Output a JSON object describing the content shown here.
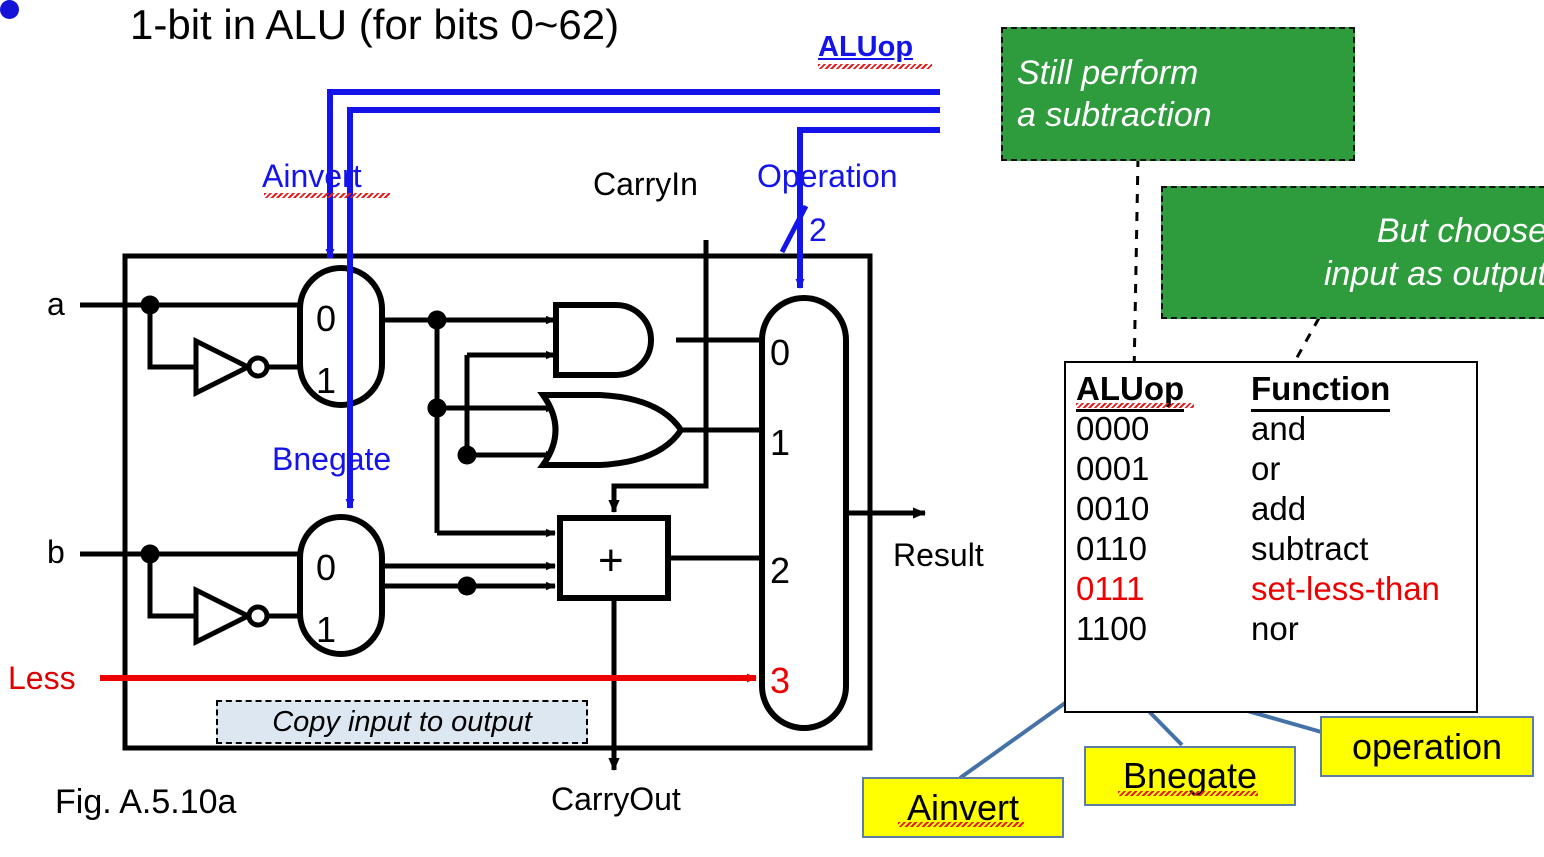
{
  "slide": {
    "title": "1-bit in ALU (for bits 0~62)",
    "figure_caption": "Fig. A.5.10a"
  },
  "signals": {
    "aluop": "ALUop",
    "ainvert": "Ainvert",
    "bnegate": "Bnegate",
    "operation": "Operation",
    "operation_width": "2",
    "carryin": "CarryIn",
    "carryout": "CarryOut",
    "input_a": "a",
    "input_b": "b",
    "less": "Less",
    "result": "Result"
  },
  "mux_ports": {
    "a_mux": [
      "0",
      "1"
    ],
    "b_mux": [
      "0",
      "1"
    ],
    "out_mux": [
      "0",
      "1",
      "2",
      "3"
    ]
  },
  "adder": {
    "symbol": "+"
  },
  "annotations": {
    "copy_tag": "Copy input to output",
    "green": [
      {
        "line1": "Still perform",
        "line2": "a subtraction"
      },
      {
        "line1": "But choose",
        "line2": "input as output"
      }
    ],
    "yellow": [
      {
        "label": "Ainvert"
      },
      {
        "label": "Bnegate"
      },
      {
        "label": "operation"
      }
    ]
  },
  "table": {
    "headers": [
      "ALUop",
      "Function"
    ],
    "rows": [
      {
        "op": "0000",
        "fn": "and",
        "highlight": false
      },
      {
        "op": "0001",
        "fn": "or",
        "highlight": false
      },
      {
        "op": "0010",
        "fn": "add",
        "highlight": false
      },
      {
        "op": "0110",
        "fn": "subtract",
        "highlight": false
      },
      {
        "op": "0111",
        "fn": "set-less-than",
        "highlight": true
      },
      {
        "op": "1100",
        "fn": "nor",
        "highlight": false
      }
    ]
  },
  "colors": {
    "control_blue": "#1414ea",
    "less_red": "#e00000",
    "highlight_red": "#ee0000",
    "callout_green": "#2e9b3c",
    "callout_yellow": "#ffff00",
    "callout_yellow_border": "#5b7ea8",
    "copy_tag_blue": "#dde7f2",
    "pointer_blue": "#4472a8"
  }
}
